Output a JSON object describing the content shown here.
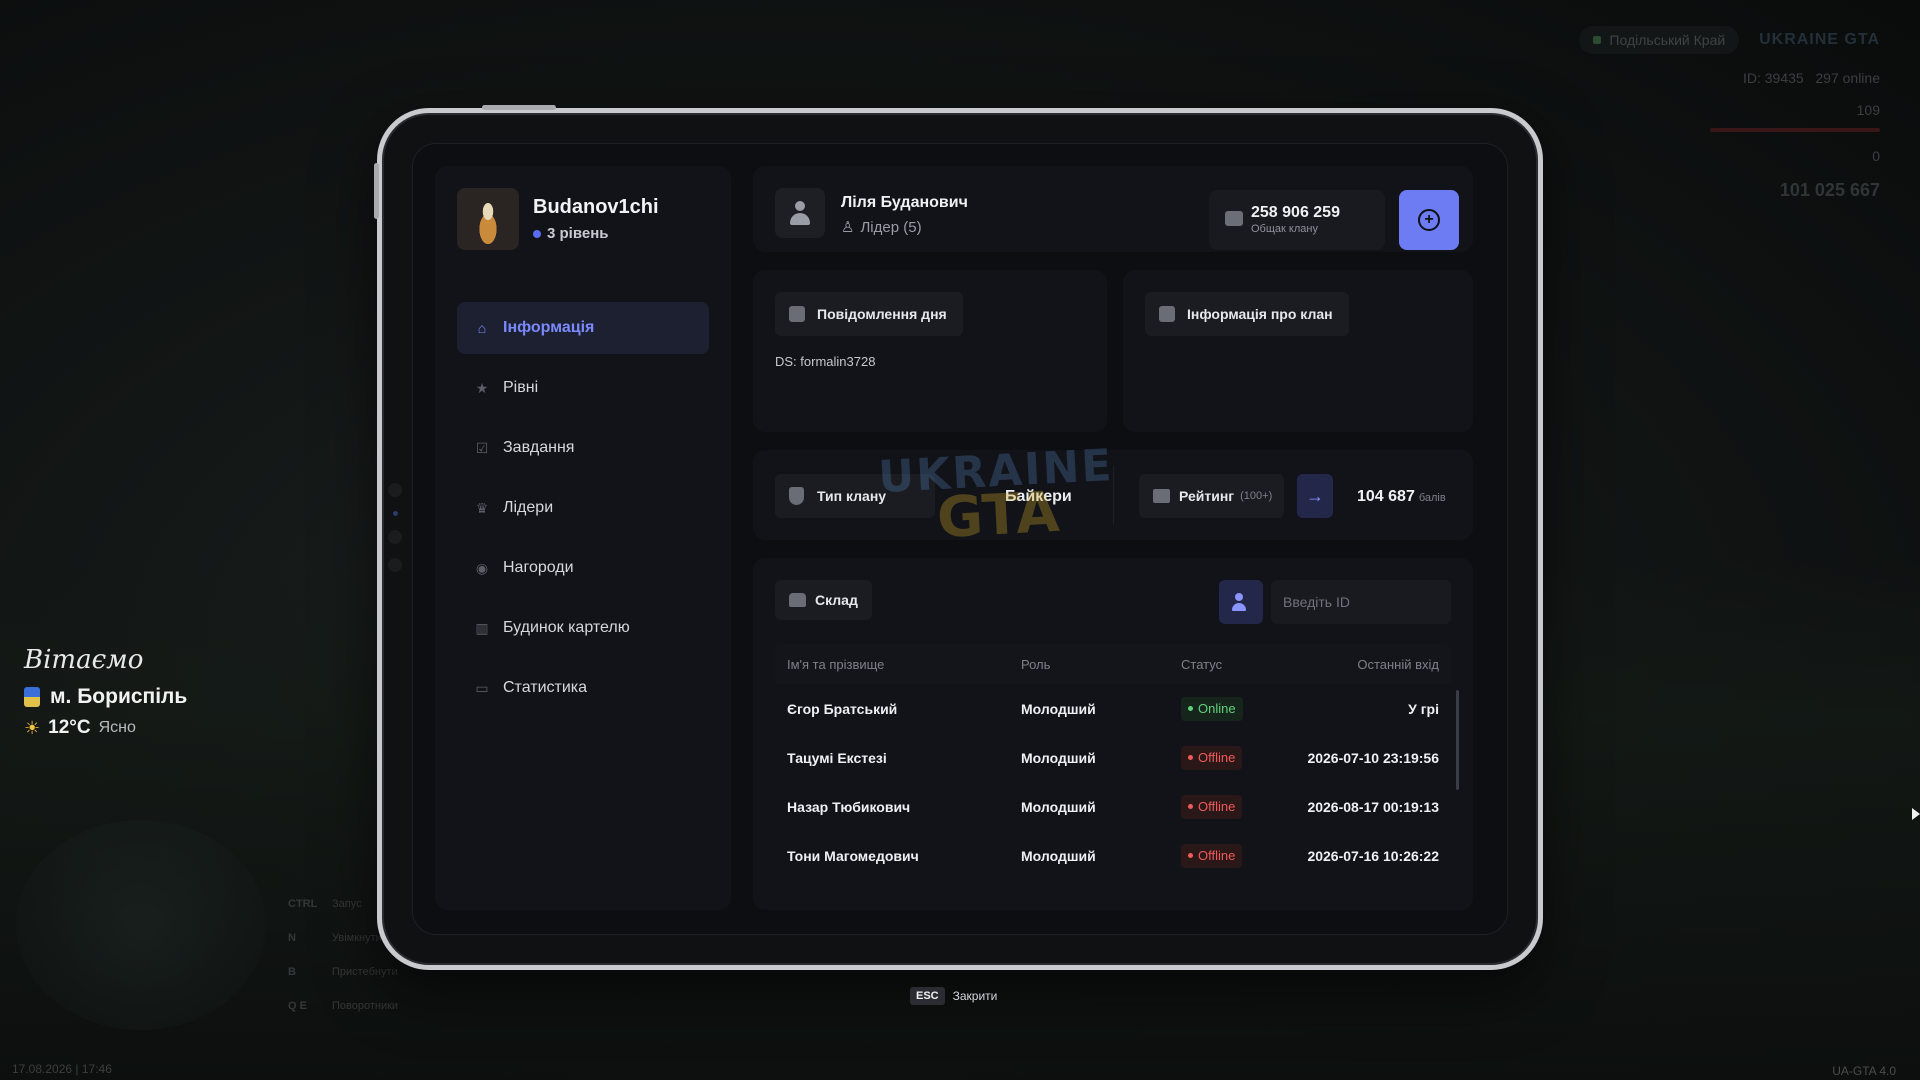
{
  "hud": {
    "server": "Подільський Край",
    "logo_text": "UKRAINE GTA",
    "player_id": "ID: 39435",
    "online": "297 online",
    "health": "109",
    "armor": "0",
    "money": "101 025 667",
    "datetime": "17.08.2026 | 17:46",
    "version": "UA-GTA 4.0",
    "hints": [
      {
        "key": "CTRL",
        "label": "Запус"
      },
      {
        "key": "N",
        "label": "Увімкнути"
      },
      {
        "key": "B",
        "label": "Пристебнути"
      },
      {
        "key": "Q E",
        "label": "Поворотники"
      }
    ]
  },
  "welcome": {
    "greeting": "Вітаємо",
    "city": "м. Бориспіль",
    "temperature": "12°C",
    "weather": "Ясно"
  },
  "sidebar": {
    "username": "Budanov1chi",
    "level": "3 рівень",
    "items": [
      {
        "label": "Інформація",
        "icon": "home-icon",
        "active": true
      },
      {
        "label": "Рівні",
        "icon": "star-icon",
        "active": false
      },
      {
        "label": "Завдання",
        "icon": "checkbox-icon",
        "active": false
      },
      {
        "label": "Лідери",
        "icon": "crown-icon",
        "active": false
      },
      {
        "label": "Нагороди",
        "icon": "medal-icon",
        "active": false
      },
      {
        "label": "Будинок картелю",
        "icon": "chart-icon",
        "active": false
      },
      {
        "label": "Статистика",
        "icon": "car-icon",
        "active": false
      }
    ]
  },
  "leader": {
    "name": "Ліля Буданович",
    "role": "Лідер (5)",
    "treasury_amount": "258 906 259",
    "treasury_label": "Общак клану"
  },
  "motd": {
    "title": "Повідомлення дня",
    "text": "DS: formalin3728"
  },
  "clan_info": {
    "title": "Інформація про клан"
  },
  "clan_type": {
    "label": "Тип клану",
    "value": "Байкери"
  },
  "rating": {
    "label": "Рейтинг",
    "sub": "(100+)",
    "value": "104 687",
    "unit": "балів"
  },
  "members": {
    "title": "Склад",
    "search_placeholder": "Введіть ID",
    "columns": [
      "Ім'я та прізвище",
      "Роль",
      "Статус",
      "Останній вхід"
    ],
    "rows": [
      {
        "name": "Єгор Братський",
        "role": "Молодший",
        "status": "Online",
        "last": "У грі"
      },
      {
        "name": "Тацумі Екстезі",
        "role": "Молодший",
        "status": "Offline",
        "last": "2026-07-10 23:19:56"
      },
      {
        "name": "Назар Тюбикович",
        "role": "Молодший",
        "status": "Offline",
        "last": "2026-08-17 00:19:13"
      },
      {
        "name": "Тони Магомедович",
        "role": "Молодший",
        "status": "Offline",
        "last": "2026-07-16 10:26:22"
      }
    ]
  },
  "footer": {
    "esc_key": "ESC",
    "esc_label": "Закрити"
  },
  "colors": {
    "accent": "#6d7cf2",
    "online": "#5fd07a",
    "offline": "#ef5a5a"
  }
}
